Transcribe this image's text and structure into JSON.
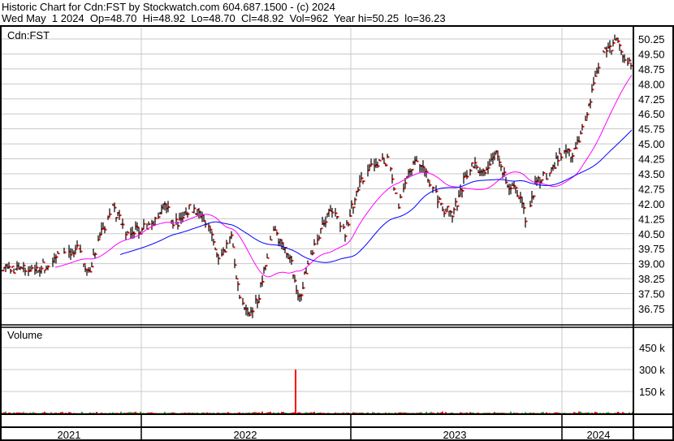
{
  "header": {
    "title": "Historic Chart for Cdn:FST by Stockwatch.com 604.687.1500 - (c) 2024",
    "quote": "Wed May  1 2024  Op=48.70  Hi=48.92  Lo=48.70  Cl=48.92  Vol=962  Year hi=50.25  lo=36.23"
  },
  "chart_data": {
    "type": "line",
    "symbol_label": "Cdn:FST",
    "volume_label": "Volume",
    "price_ticks": [
      "50.25",
      "49.50",
      "48.75",
      "48.00",
      "47.25",
      "46.50",
      "45.75",
      "45.00",
      "44.25",
      "43.50",
      "42.75",
      "42.00",
      "41.25",
      "40.50",
      "39.75",
      "39.00",
      "38.25",
      "37.50",
      "36.75"
    ],
    "price_ylim": [
      36.75,
      50.25
    ],
    "volume_ticks": [
      "450 k",
      "300 k",
      "150 k"
    ],
    "volume_ylim": [
      0,
      450000
    ],
    "years": [
      "2021",
      "2022",
      "2023",
      "2024"
    ],
    "close_series": {
      "note_units": "x in trading days from start, y in CAD",
      "x": [
        5,
        30,
        60,
        75,
        95,
        110,
        125,
        140,
        155,
        175,
        190,
        205,
        215,
        235,
        250,
        262,
        270,
        285,
        295,
        310,
        320,
        335,
        350,
        358,
        368,
        380,
        395,
        410,
        425,
        440,
        460,
        478,
        490,
        505,
        515,
        530,
        545,
        558,
        570,
        580,
        595,
        610,
        625,
        640,
        648,
        660,
        675,
        690,
        705,
        715,
        725,
        735,
        745,
        760,
        770,
        778
      ],
      "y": [
        38.8,
        38.7,
        38.9,
        39.6,
        39.7,
        38.6,
        40.5,
        41.8,
        40.5,
        40.7,
        41.2,
        42.0,
        40.9,
        41.8,
        41.5,
        40.2,
        39.0,
        40.3,
        37.2,
        36.4,
        37.6,
        40.8,
        39.8,
        39.3,
        37.0,
        39.3,
        40.7,
        41.8,
        40.6,
        42.8,
        44.0,
        44.2,
        41.8,
        43.8,
        44.3,
        43.0,
        41.8,
        41.5,
        43.0,
        44.0,
        43.5,
        44.5,
        43.0,
        42.5,
        41.2,
        43.0,
        43.5,
        44.5,
        44.6,
        45.4,
        46.8,
        48.5,
        49.7,
        50.1,
        49.2,
        48.9
      ]
    },
    "volume_spike": {
      "day": 363,
      "value": 300000
    },
    "moving_averages": [
      {
        "period": 50,
        "color": "#ff00ff"
      },
      {
        "period": 150,
        "color": "#0000ff"
      }
    ],
    "colors": {
      "bar": "#000000",
      "close_dot": "#ff0000",
      "vol_up": "#3a9a3a",
      "vol_down": "#ff0000",
      "grid": "#c8c8c8"
    }
  }
}
